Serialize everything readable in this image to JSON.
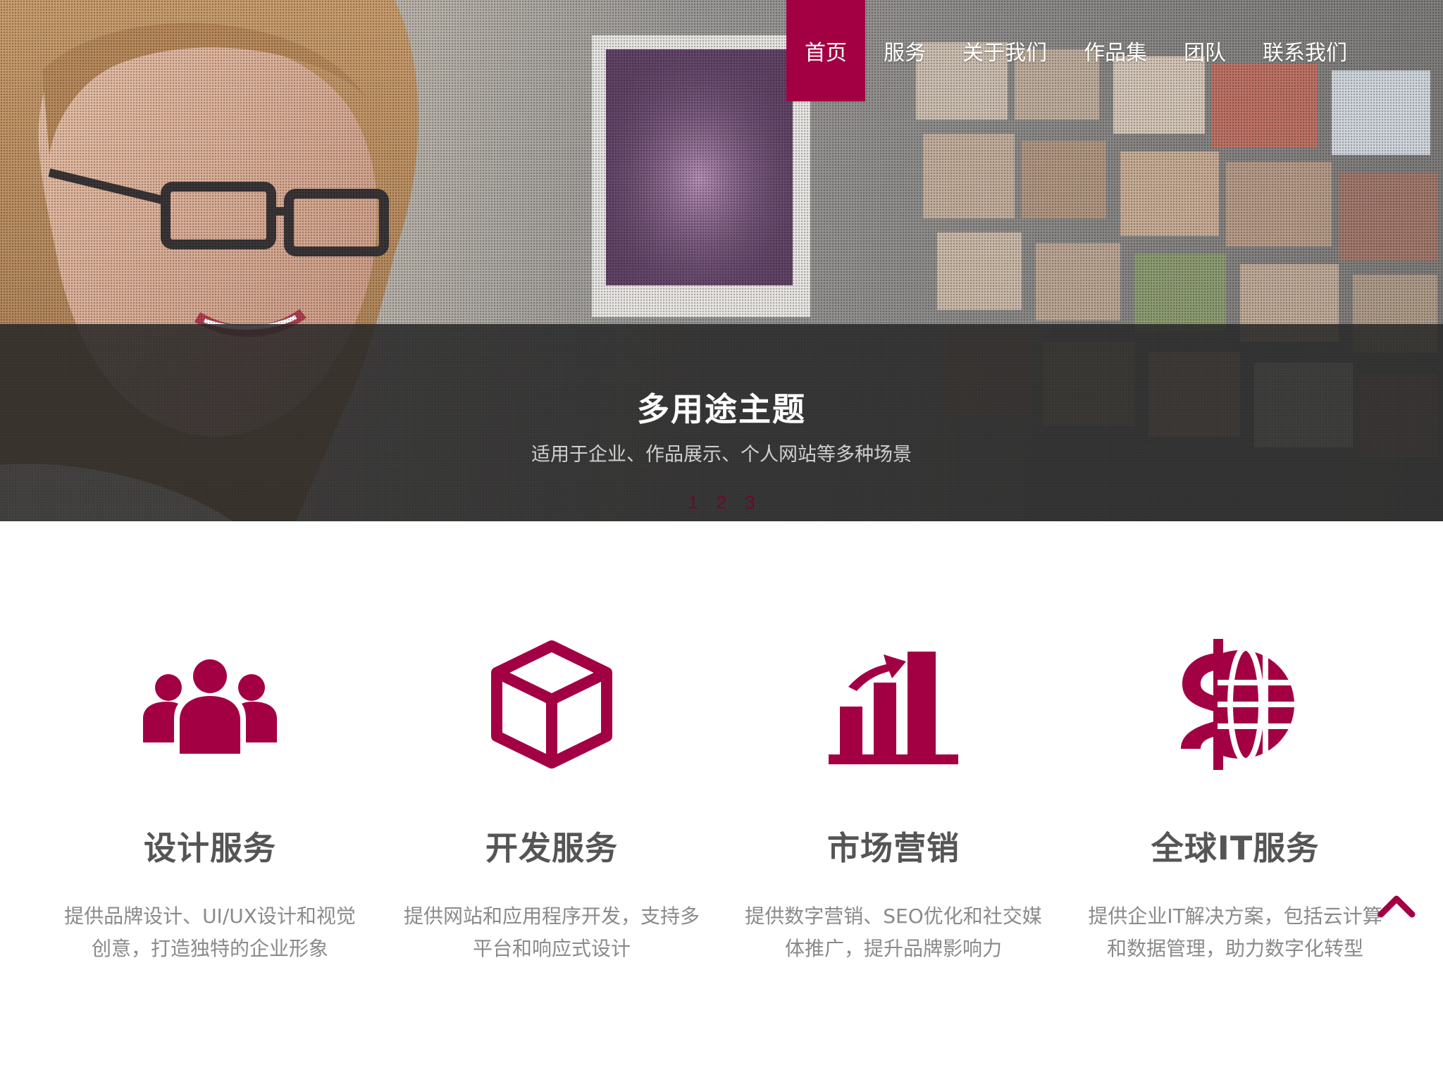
{
  "nav": {
    "items": [
      {
        "label": "首页",
        "active": true
      },
      {
        "label": "服务",
        "active": false
      },
      {
        "label": "关于我们",
        "active": false
      },
      {
        "label": "作品集",
        "active": false
      },
      {
        "label": "团队",
        "active": false
      },
      {
        "label": "联系我们",
        "active": false
      }
    ]
  },
  "hero": {
    "title": "多用途主题",
    "subtitle": "适用于企业、作品展示、个人网站等多种场景",
    "pager": [
      "1",
      "2",
      "3"
    ]
  },
  "services": [
    {
      "icon": "users-icon",
      "title": "设计服务",
      "desc": "提供品牌设计、UI/UX设计和视觉创意，打造独特的企业形象"
    },
    {
      "icon": "cube-icon",
      "title": "开发服务",
      "desc": "提供网站和应用程序开发，支持多平台和响应式设计"
    },
    {
      "icon": "bar-chart-icon",
      "title": "市场营销",
      "desc": "提供数字营销、SEO优化和社交媒体推广，提升品牌影响力"
    },
    {
      "icon": "globe-dollar-icon",
      "title": "全球IT服务",
      "desc": "提供企业IT解决方案，包括云计算和数据管理，助力数字化转型"
    }
  ],
  "colors": {
    "accent": "#a30044",
    "text": "#555555",
    "muted": "#8a8a8a"
  }
}
